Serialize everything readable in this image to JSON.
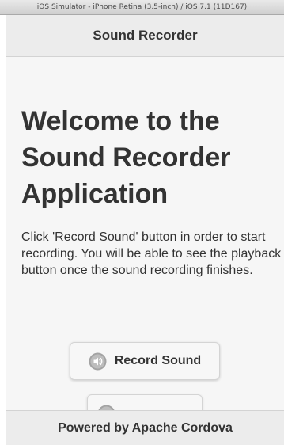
{
  "simulator": {
    "title": "iOS Simulator - iPhone Retina (3.5-inch) / iOS 7.1 (11D167)"
  },
  "header": {
    "title": "Sound Recorder"
  },
  "main": {
    "welcome_heading": "Welcome to the Sound Recorder Application",
    "description": "Click 'Record Sound' button in order to start recording. You will be able to see the playback button once the sound recording finishes.",
    "record_button": {
      "label": "Record Sound",
      "icon": "microphone-icon"
    },
    "playback_button": {
      "icon": "play-icon"
    }
  },
  "footer": {
    "text": "Powered by Apache Cordova"
  },
  "colors": {
    "background": "#f6f6f6",
    "bar": "#ececec",
    "text": "#333333",
    "button_icon": "#9a9a9a"
  }
}
